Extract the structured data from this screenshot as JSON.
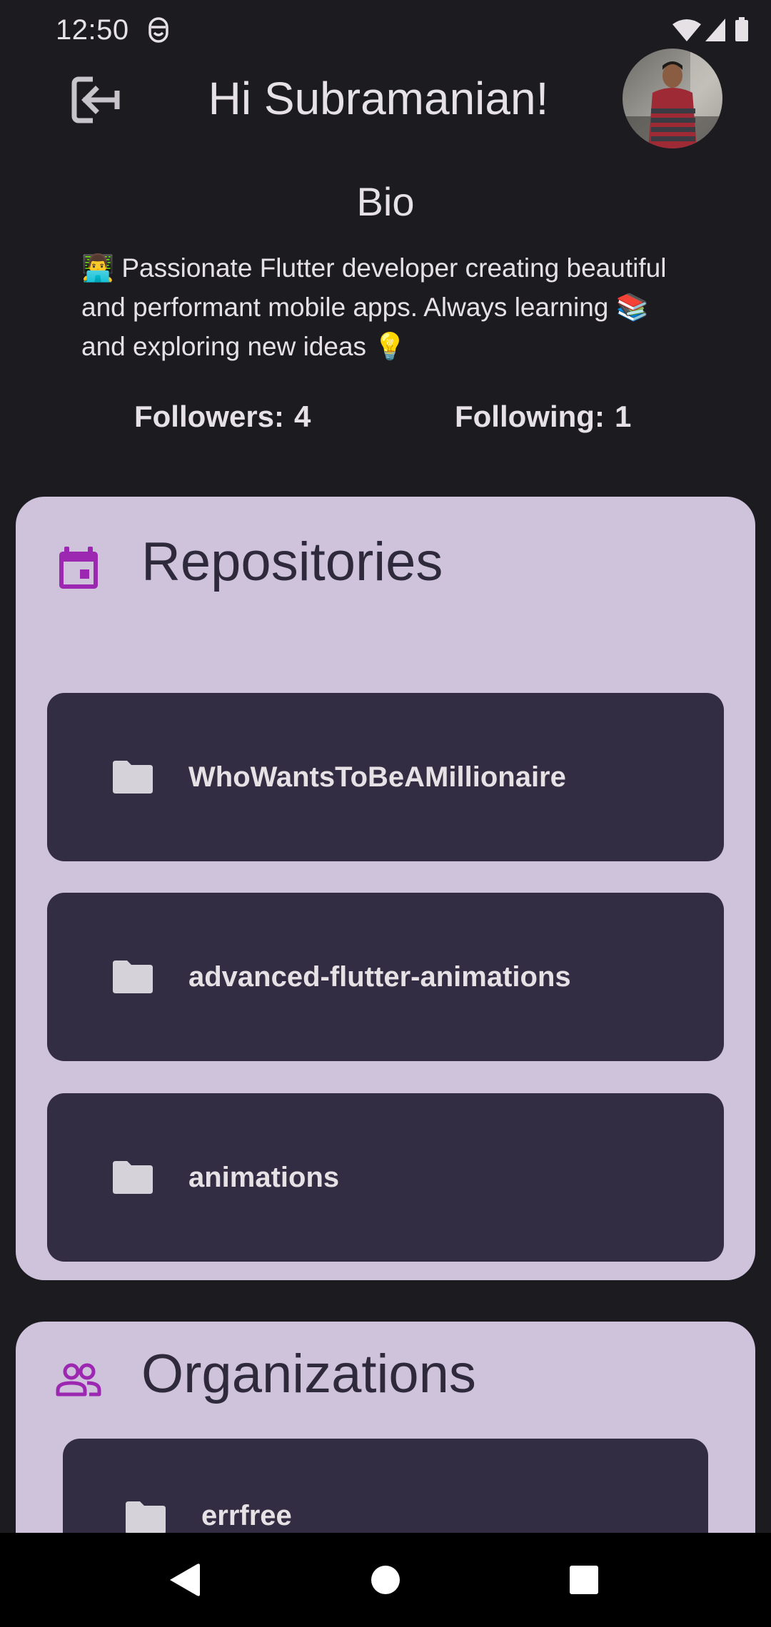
{
  "status_bar": {
    "time": "12:50"
  },
  "header": {
    "greeting": "Hi Subramanian!"
  },
  "bio": {
    "title": "Bio",
    "text": "👨‍💻 Passionate Flutter developer creating beautiful and performant mobile apps. Always learning 📚 and exploring new ideas 💡"
  },
  "stats": {
    "followers_label": "Followers:",
    "followers_count": "4",
    "following_label": "Following:",
    "following_count": "1"
  },
  "repositories": {
    "title": "Repositories",
    "items": [
      {
        "name": "WhoWantsToBeAMillionaire"
      },
      {
        "name": "advanced-flutter-animations"
      },
      {
        "name": "animations"
      }
    ]
  },
  "organizations": {
    "title": "Organizations",
    "items": [
      {
        "name": "errfree"
      }
    ]
  },
  "colors": {
    "background": "#1c1b20",
    "card": "#cfc2db",
    "item": "#322d42",
    "accent": "#9c27b0"
  },
  "icons": {
    "back": "logout-arrow-icon",
    "repos": "calendar-icon",
    "orgs": "people-icon",
    "item": "folder-icon"
  }
}
